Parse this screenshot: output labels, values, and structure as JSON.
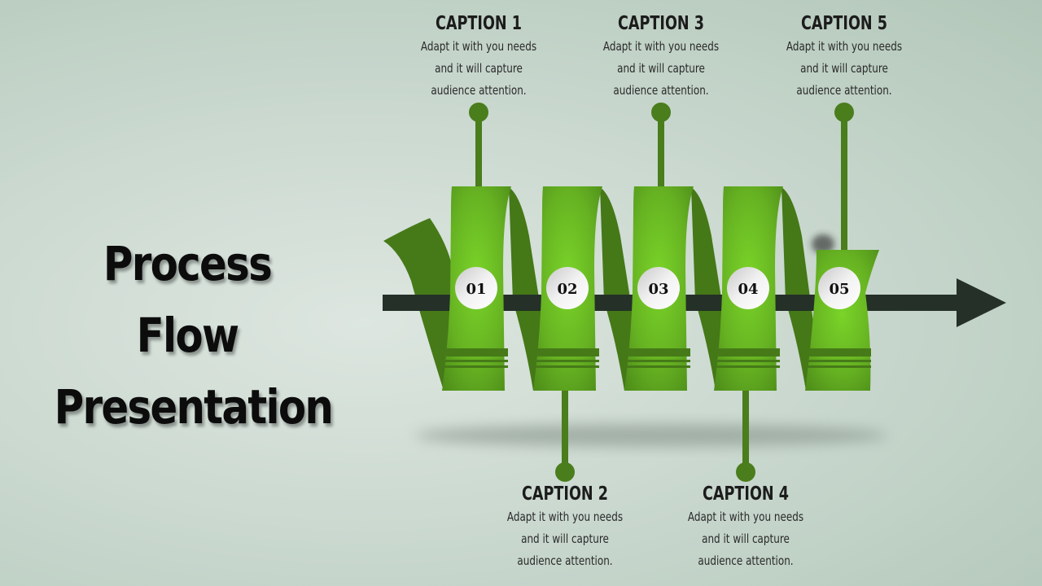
{
  "title": {
    "line1": "Process Flow",
    "line2": "Presentation"
  },
  "colors": {
    "ribbon_light": "#74c726",
    "ribbon_dark": "#467a18",
    "connector": "#4a7d1c",
    "arrow": "#243028"
  },
  "steps": [
    {
      "number": "01",
      "caption": "CAPTION 1",
      "text_lines": [
        "Adapt it with you needs",
        "and it will capture",
        "audience attention."
      ],
      "position": "top"
    },
    {
      "number": "02",
      "caption": "CAPTION 2",
      "text_lines": [
        "Adapt it with you needs",
        "and it will capture",
        "audience attention."
      ],
      "position": "bottom"
    },
    {
      "number": "03",
      "caption": "CAPTION 3",
      "text_lines": [
        "Adapt it with you needs",
        "and it will capture",
        "audience attention."
      ],
      "position": "top"
    },
    {
      "number": "04",
      "caption": "CAPTION 4",
      "text_lines": [
        "Adapt it with you needs",
        "and it will capture",
        "audience attention."
      ],
      "position": "bottom"
    },
    {
      "number": "05",
      "caption": "CAPTION 5",
      "text_lines": [
        "Adapt it with you needs",
        "and it will capture",
        "audience attention."
      ],
      "position": "top"
    }
  ]
}
